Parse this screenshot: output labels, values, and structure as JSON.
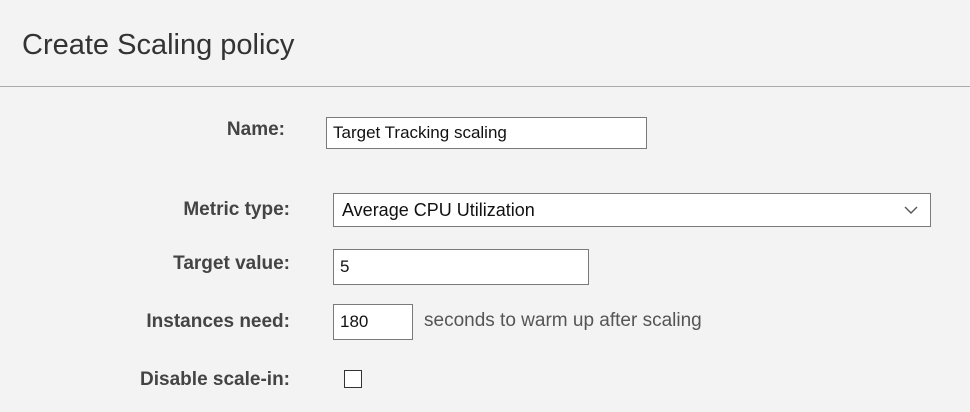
{
  "dialog": {
    "title": "Create Scaling policy"
  },
  "form": {
    "name": {
      "label": "Name:",
      "value": "Target Tracking scaling"
    },
    "metric_type": {
      "label": "Metric type:",
      "selected": "Average CPU Utilization",
      "icon": "chevron-down-icon"
    },
    "target_value": {
      "label": "Target value:",
      "value": "5"
    },
    "instances_need": {
      "label": "Instances need:",
      "value": "180",
      "suffix": "seconds to warm up after scaling"
    },
    "disable_scale_in": {
      "label": "Disable scale-in:",
      "checked": false
    }
  }
}
